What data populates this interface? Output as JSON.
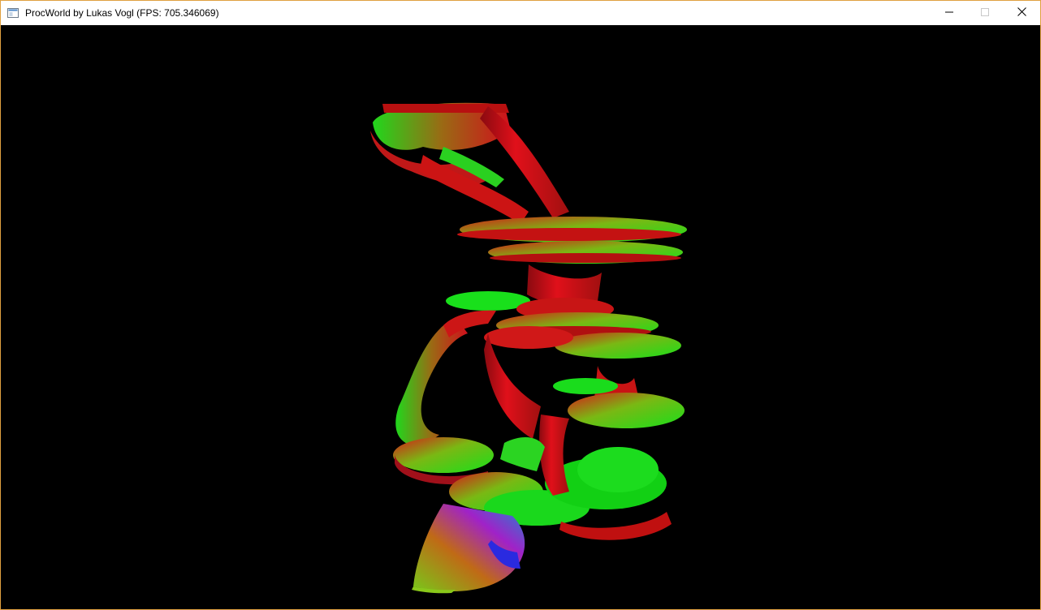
{
  "window": {
    "title": "ProcWorld by Lukas Vogl (FPS: 705.346069)",
    "border_color": "#e0a040"
  },
  "titlebar": {
    "app_icon": "window-app-icon",
    "controls": [
      {
        "name": "minimize",
        "icon": "minimize-icon"
      },
      {
        "name": "maximize",
        "icon": "maximize-icon"
      },
      {
        "name": "close",
        "icon": "close-icon"
      }
    ]
  },
  "viewport": {
    "background": "#000000",
    "palette": {
      "red": "#e0101a",
      "dark_red": "#8a0a10",
      "green": "#19e01b",
      "dark_green": "#0f8a10",
      "blue": "#2a2ae0",
      "magenta": "#a022c8"
    }
  }
}
